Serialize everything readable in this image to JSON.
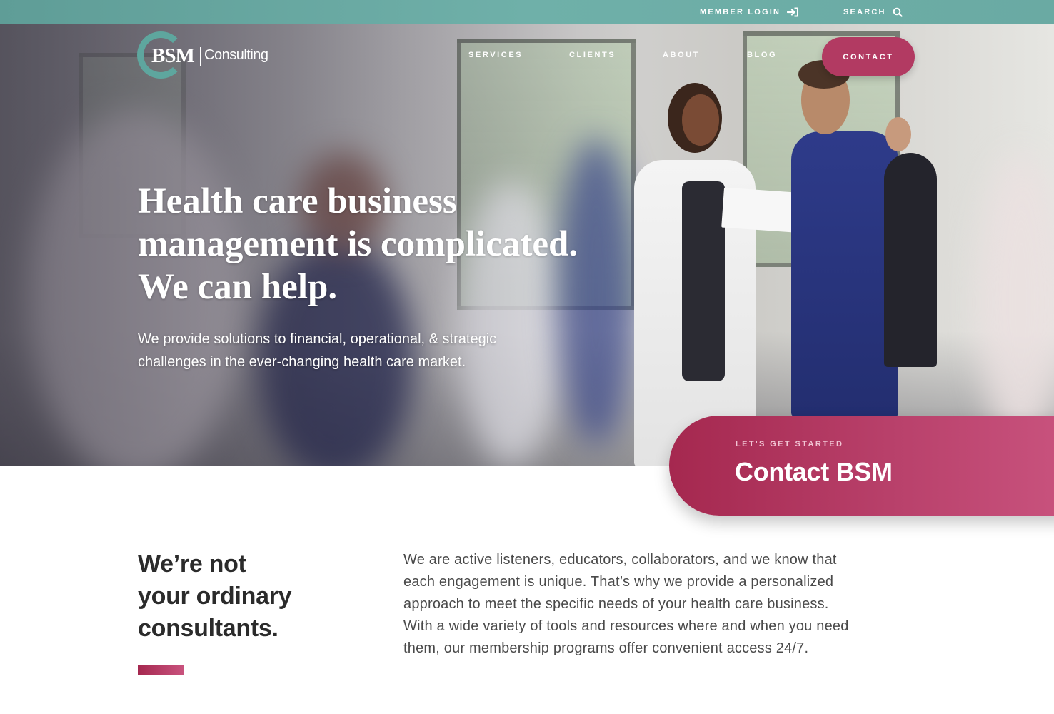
{
  "utility_bar": {
    "member_login": "MEMBER LOGIN",
    "search": "SEARCH"
  },
  "logo": {
    "mark": "BSM",
    "wordmark": "Consulting"
  },
  "nav": {
    "items": [
      {
        "label": "SERVICES"
      },
      {
        "label": "CLIENTS"
      },
      {
        "label": "ABOUT"
      },
      {
        "label": "BLOG"
      }
    ],
    "contact": "CONTACT"
  },
  "hero": {
    "title_lines": [
      "Health care business",
      "management is complicated.",
      "We can help."
    ],
    "subtitle_lines": [
      "We provide solutions to financial, operational, & strategic",
      "challenges in the ever-changing health care market."
    ]
  },
  "cta": {
    "eyebrow": "LET'S GET STARTED",
    "title": "Contact BSM"
  },
  "about": {
    "heading_lines": [
      "We’re not",
      "your ordinary",
      "consultants."
    ],
    "body_lines": [
      "We are active listeners, educators, collaborators, and we know that",
      "each engagement is unique. That’s why we provide a personalized",
      "approach to meet the specific needs of your health care business.",
      "With a wide variety of tools and resources where and when you need",
      "them, our membership programs offer convenient access 24/7."
    ]
  },
  "icons": {
    "login": "login-arrow-icon",
    "search": "search-icon"
  },
  "colors": {
    "teal": "#6aaaa3",
    "brand_magenta": "#b23a62",
    "heading_dark": "#2b2b2b"
  }
}
